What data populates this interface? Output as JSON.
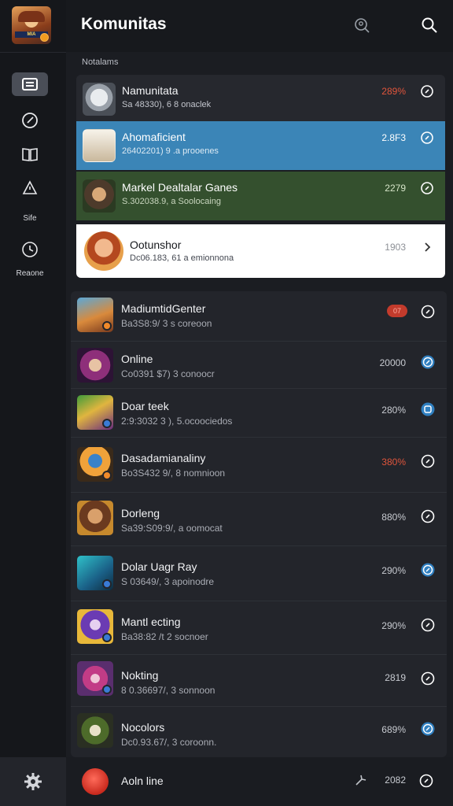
{
  "header": {
    "title": "Komunitas"
  },
  "section_label": "Notalams",
  "rail": {
    "items": [
      {
        "icon": "list-icon",
        "label": ""
      },
      {
        "icon": "compass-icon",
        "label": ""
      },
      {
        "icon": "book-icon",
        "label": ""
      },
      {
        "icon": "alert-icon",
        "label": "Sife"
      },
      {
        "icon": "clock-icon",
        "label": "Reaone"
      }
    ]
  },
  "pinned": [
    {
      "name": "Namunitata",
      "sub": "Sa 48330), 6 8 onaclek",
      "value": "289%",
      "value_color": "#e0553c"
    },
    {
      "name": "Ahomaficient",
      "sub": "26402201) 9 .a prooenes",
      "value": "2.8F3",
      "value_color": "#ffffff"
    },
    {
      "name": "Markel Dealtalar Ganes",
      "sub": "S.302038.9, a Soolocaing",
      "value": "2279",
      "value_color": "#d6e4c8"
    },
    {
      "name": "Ootunshor",
      "sub": "Dc06.183, 61 a emionnona",
      "value": "1903",
      "value_color": "#8d9096"
    }
  ],
  "list": [
    {
      "name": "MadiumtidGenter",
      "sub": "Ba3S8:9/ 3 s coreoon",
      "value": "07",
      "value_type": "pill"
    },
    {
      "name": "Online",
      "sub": "Co0391 $7) 3 conoocr",
      "value": "20000",
      "value_type": "plain"
    },
    {
      "name": "Doar teek",
      "sub": "2:9:3032 3 ), 5.ocoociedos",
      "value": "280%",
      "value_type": "plain"
    },
    {
      "name": "Dasadamianaliny",
      "sub": "Bo3S432 9/, 8 nomnioon",
      "value": "380%",
      "value_type": "red"
    },
    {
      "name": "Dorleng",
      "sub": "Sa39:S09:9/, a oomocat",
      "value": "880%",
      "value_type": "plain"
    },
    {
      "name": "Dolar Uagr Ray",
      "sub": "S 03649/, 3 apoinodre",
      "value": "290%",
      "value_type": "plain"
    },
    {
      "name": "Mantl ecting",
      "sub": "Ba38:82 /t 2 socnoer",
      "value": "290%",
      "value_type": "plain"
    },
    {
      "name": "Nokting",
      "sub": "8 0.36697/, 3 sonnoon",
      "value": "2819",
      "value_type": "plain"
    },
    {
      "name": "Nocolors",
      "sub": "Dc0.93.67/, 3 coroonn.",
      "value": "689%",
      "value_type": "plain"
    }
  ],
  "footer": {
    "name": "Aoln line",
    "value": "2082"
  }
}
